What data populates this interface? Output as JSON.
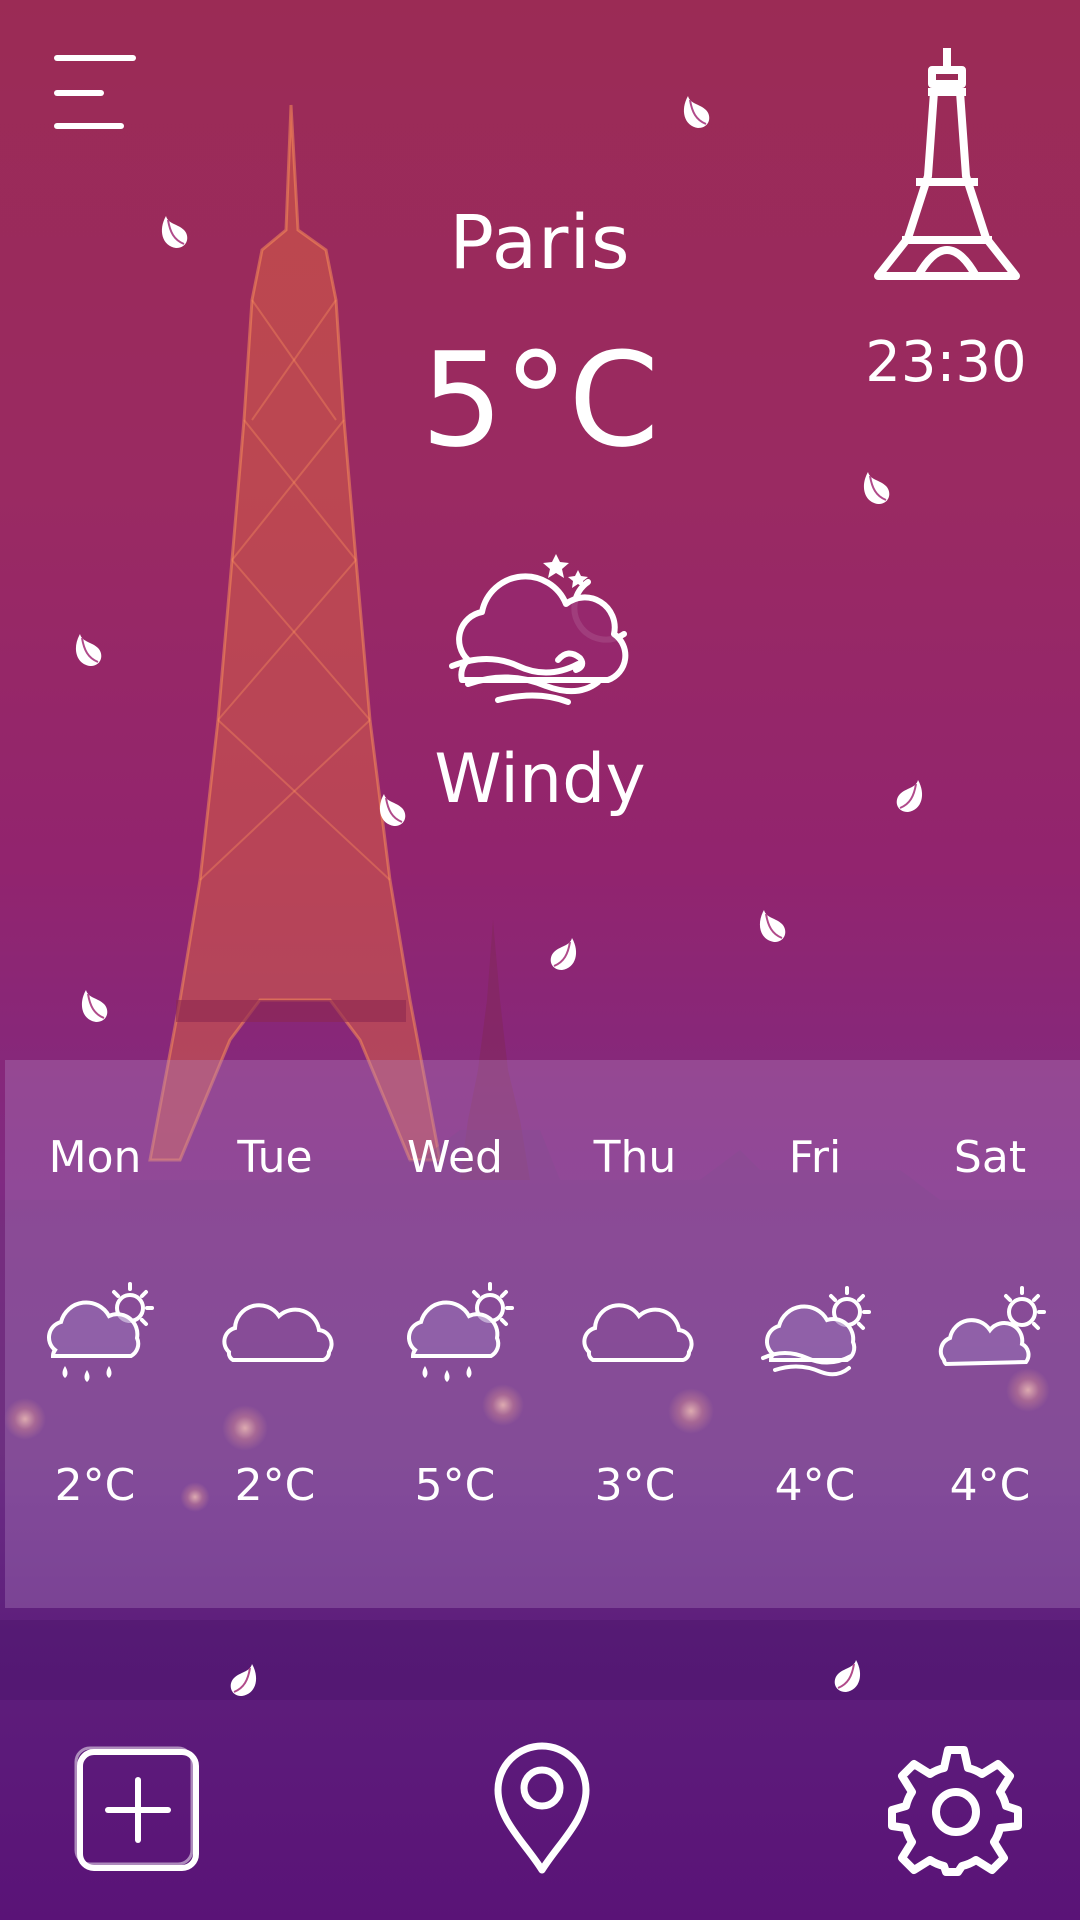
{
  "header": {
    "menu_icon": "hamburger-menu-icon",
    "landmark_icon": "eiffel-tower-icon"
  },
  "current": {
    "city": "Paris",
    "temperature": "5°C",
    "time": "23:30",
    "condition": "Windy",
    "condition_icon": "windy-night-cloud-moon-icon"
  },
  "forecast": [
    {
      "day": "Mon",
      "temp": "2°C",
      "icon": "rain-sun-icon"
    },
    {
      "day": "Tue",
      "temp": "2°C",
      "icon": "cloud-icon"
    },
    {
      "day": "Wed",
      "temp": "5°C",
      "icon": "rain-sun-icon"
    },
    {
      "day": "Thu",
      "temp": "3°C",
      "icon": "cloud-icon"
    },
    {
      "day": "Fri",
      "temp": "4°C",
      "icon": "windy-cloud-sun-icon"
    },
    {
      "day": "Sat",
      "temp": "4°C",
      "icon": "cloud-sun-icon"
    }
  ],
  "bottom_nav": {
    "add_icon": "add-square-icon",
    "location_icon": "location-pin-icon",
    "settings_icon": "gear-icon"
  },
  "colors": {
    "top": "#9b2b55",
    "middle": "#92246e",
    "bottom": "#5a1377",
    "panel": "#b48cc8",
    "text": "#ffffff"
  }
}
